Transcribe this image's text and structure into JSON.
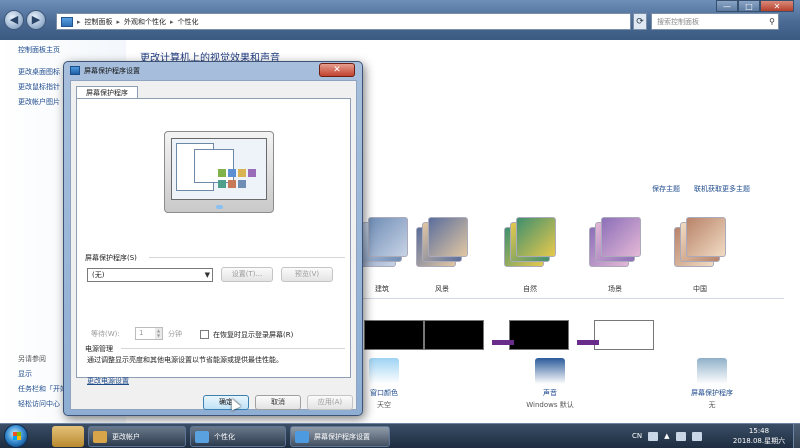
{
  "explorer": {
    "breadcrumbs": [
      "控制面板",
      "外观和个性化",
      "个性化"
    ],
    "search_placeholder": "搜索控制面板",
    "left_nav": {
      "home": "控制面板主页",
      "links": [
        "更改桌面图标",
        "更改鼠标指针",
        "更改帐户图片"
      ],
      "see_also_heading": "另请参阅",
      "see_also": [
        "显示",
        "任务栏和「开始」菜单",
        "轻松访问中心"
      ]
    },
    "main_title": "更改计算机上的视觉效果和声音",
    "theme_links": {
      "save": "保存主题",
      "online": "联机获取更多主题"
    },
    "themes": [
      {
        "label": "建筑",
        "color_a": "#6f8db5",
        "color_b": "#c8d3e6"
      },
      {
        "label": "风景",
        "color_a": "#5a6e9c",
        "color_b": "#e2c7a3"
      },
      {
        "label": "自然",
        "color_a": "#3f8f6e",
        "color_b": "#e7c94d"
      },
      {
        "label": "场景",
        "color_a": "#8b6fb8",
        "color_b": "#e4b8d6"
      },
      {
        "label": "中国",
        "color_a": "#b8836a",
        "color_b": "#f1dcc3"
      }
    ],
    "bottom_items": [
      {
        "label": "窗口颜色",
        "sub": "天空",
        "icon": "window-color-icon",
        "color": "#9ed3f3"
      },
      {
        "label": "声音",
        "sub": "Windows 默认",
        "icon": "sound-icon",
        "color": "#2b5b9a"
      },
      {
        "label": "屏幕保护程序",
        "sub": "无",
        "icon": "screensaver-icon",
        "color": "#8fb0c9"
      }
    ]
  },
  "dialog": {
    "title": "屏幕保护程序设置",
    "tab": "屏幕保护程序",
    "screensaver_group": "屏幕保护程序(S)",
    "selected": "(无)",
    "settings_btn": "设置(T)...",
    "preview_btn": "预览(V)",
    "wait_label": "等待(W):",
    "wait_value": "1",
    "wait_unit": "分钟",
    "resume_label": "在恢复时显示登录屏幕(R)",
    "power_group": "电源管理",
    "power_desc": "通过调整显示亮度和其他电源设置以节省能源或提供最佳性能。",
    "power_link": "更改电源设置",
    "ok_btn": "确定",
    "cancel_btn": "取消",
    "apply_btn": "应用(A)"
  },
  "taskbar": {
    "tasks": [
      {
        "label": "更改帐户",
        "color": "#d9a54a"
      },
      {
        "label": "个性化",
        "color": "#5aa1e0"
      },
      {
        "label": "屏幕保护程序设置",
        "color": "#4d9ae0"
      }
    ],
    "tray_lang": "CN",
    "time": "15:48",
    "date": "2018.08.星期六"
  }
}
